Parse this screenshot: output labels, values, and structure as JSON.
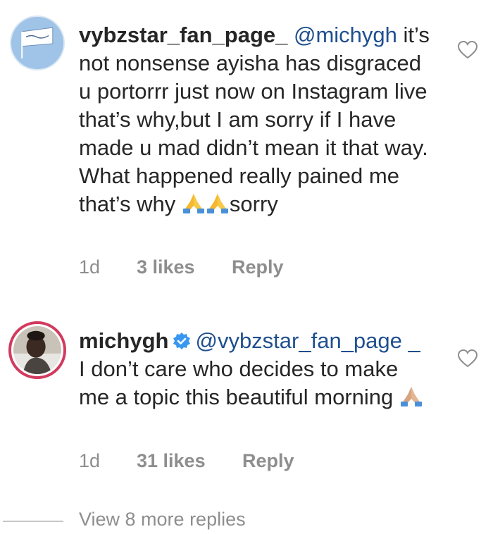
{
  "comments": [
    {
      "username": "vybzstar_fan_page_",
      "mention": "@michygh",
      "text": "it’s not nonsense ayisha has disgraced u portorrr just now on Instagram live that’s why,but I am sorry if I have made u mad didn’t mean it that way. What happened really pained me that’s why",
      "trailing_text": "sorry",
      "emoji": [
        "folded-hands-emoji",
        "folded-hands-emoji"
      ],
      "time": "1d",
      "likes": "3 likes",
      "reply": "Reply",
      "verified": false,
      "avatar_color": "#9fc4e8"
    },
    {
      "username": "michygh",
      "mention": "@vybzstar_fan_page _",
      "text": "I don’t care who decides to make me a topic this beautiful morning",
      "emoji": [
        "folded-hands-emoji"
      ],
      "time": "1d",
      "likes": "31 likes",
      "reply": "Reply",
      "verified": true,
      "avatar_color": "#d23a5e"
    }
  ],
  "view_more": {
    "label": "View 8 more replies"
  },
  "colors": {
    "text": "#262626",
    "mention": "#1f4f8f",
    "meta": "#8e8e8e",
    "verified": "#3897f0",
    "story_ring": "#d23a5e"
  }
}
